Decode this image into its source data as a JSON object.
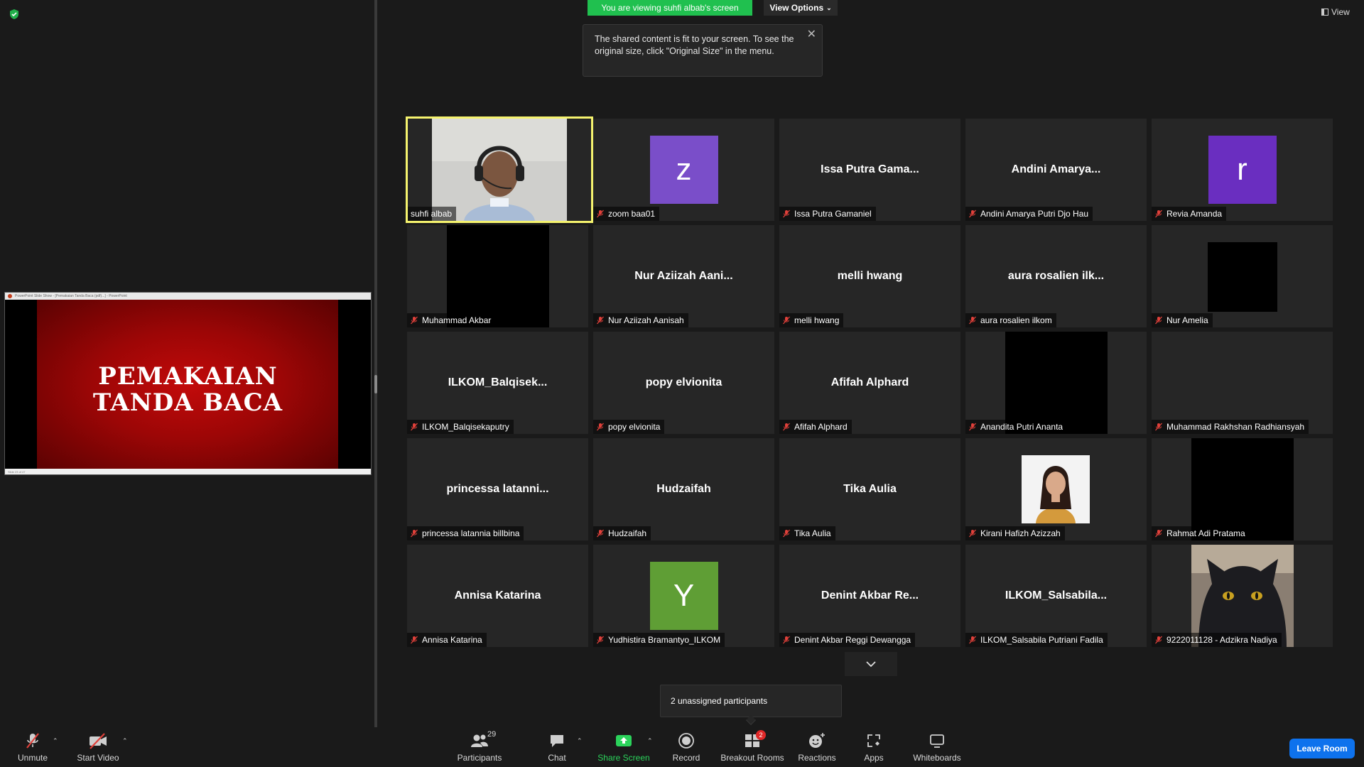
{
  "banner": {
    "text": "You are viewing suhfi albab's screen"
  },
  "view_options": {
    "label": "View Options"
  },
  "tooltip": {
    "text": "The shared content is fit to your screen. To see the original size, click \"Original Size\" in the menu."
  },
  "view_button": {
    "label": "View"
  },
  "shared_slide": {
    "window_title": "PowerPoint Slide Show - [Pemakaian Tanda Baca (pdf)...] - PowerPoint",
    "title_line1": "PEMAKAIAN",
    "title_line2": "TANDA BACA",
    "status": "Slide 23 of 47"
  },
  "tiles": [
    {
      "name": "suhfi albab",
      "big": "",
      "kind": "video-person",
      "muted": false,
      "active": true
    },
    {
      "name": "zoom baa01",
      "big": "",
      "kind": "letter",
      "letter": "z",
      "color": "#7a4ec9",
      "muted": true
    },
    {
      "name": "Issa Putra Gamaniel",
      "big": "Issa Putra Gama...",
      "kind": "name",
      "muted": true
    },
    {
      "name": "Andini Amarya Putri Djo Hau",
      "big": "Andini Amarya...",
      "kind": "name",
      "muted": true
    },
    {
      "name": "Revia Amanda",
      "big": "",
      "kind": "letter",
      "letter": "r",
      "color": "#6a2ec0",
      "muted": true
    },
    {
      "name": "Muhammad Akbar",
      "big": "",
      "kind": "black-tall",
      "muted": true
    },
    {
      "name": "Nur Aziizah Aanisah",
      "big": "Nur Aziizah Aani...",
      "kind": "name",
      "muted": true
    },
    {
      "name": "melli hwang",
      "big": "melli hwang",
      "kind": "name",
      "muted": true
    },
    {
      "name": "aura rosalien ilkom",
      "big": "aura rosalien ilk...",
      "kind": "name",
      "muted": true
    },
    {
      "name": "Nur Amelia",
      "big": "",
      "kind": "black-square",
      "muted": true
    },
    {
      "name": "ILKOM_Balqisekaputry",
      "big": "ILKOM_Balqisek...",
      "kind": "name",
      "muted": true
    },
    {
      "name": "popy elvionita",
      "big": "popy elvionita",
      "kind": "name",
      "muted": true
    },
    {
      "name": "Afifah Alphard",
      "big": "Afifah Alphard",
      "kind": "name",
      "muted": true
    },
    {
      "name": "Anandita Putri Ananta",
      "big": "",
      "kind": "black-tall",
      "muted": true
    },
    {
      "name": "Muhammad Rakhshan Radhiansyah",
      "big": "",
      "kind": "empty",
      "muted": true
    },
    {
      "name": "princessa latannia billbina",
      "big": "princessa latanni...",
      "kind": "name",
      "muted": true
    },
    {
      "name": "Hudzaifah",
      "big": "Hudzaifah",
      "kind": "name",
      "muted": true
    },
    {
      "name": "Tika Aulia",
      "big": "Tika Aulia",
      "kind": "name",
      "muted": true
    },
    {
      "name": "Kirani Hafizh Azizzah",
      "big": "",
      "kind": "photo-woman",
      "muted": true
    },
    {
      "name": "Rahmat Adi Pratama",
      "big": "",
      "kind": "black-tall",
      "muted": true
    },
    {
      "name": "Annisa Katarina",
      "big": "Annisa Katarina",
      "kind": "name",
      "muted": true
    },
    {
      "name": "Yudhistira Bramantyo_ILKOM",
      "big": "",
      "kind": "letter",
      "letter": "Y",
      "color": "#5f9e35",
      "muted": true
    },
    {
      "name": "Denint Akbar Reggi Dewangga",
      "big": "Denint Akbar Re...",
      "kind": "name",
      "muted": true
    },
    {
      "name": "ILKOM_Salsabila Putriani Fadila",
      "big": "ILKOM_Salsabila...",
      "kind": "name",
      "muted": true
    },
    {
      "name": "9222011128 - Adzikra Nadiya",
      "big": "",
      "kind": "photo-cat",
      "muted": true
    }
  ],
  "unassigned": {
    "text": "2 unassigned participants"
  },
  "toolbar": {
    "unmute": "Unmute",
    "start_video": "Start Video",
    "participants": "Participants",
    "participants_count": "29",
    "chat": "Chat",
    "share_screen": "Share Screen",
    "record": "Record",
    "breakout_rooms": "Breakout Rooms",
    "breakout_badge": "2",
    "reactions": "Reactions",
    "apps": "Apps",
    "whiteboards": "Whiteboards",
    "leave_room": "Leave Room"
  },
  "colors": {
    "accent_green": "#20c04f",
    "active_border": "#f5f36e",
    "leave_blue": "#0e72ed",
    "mute_red": "#e0403a"
  }
}
